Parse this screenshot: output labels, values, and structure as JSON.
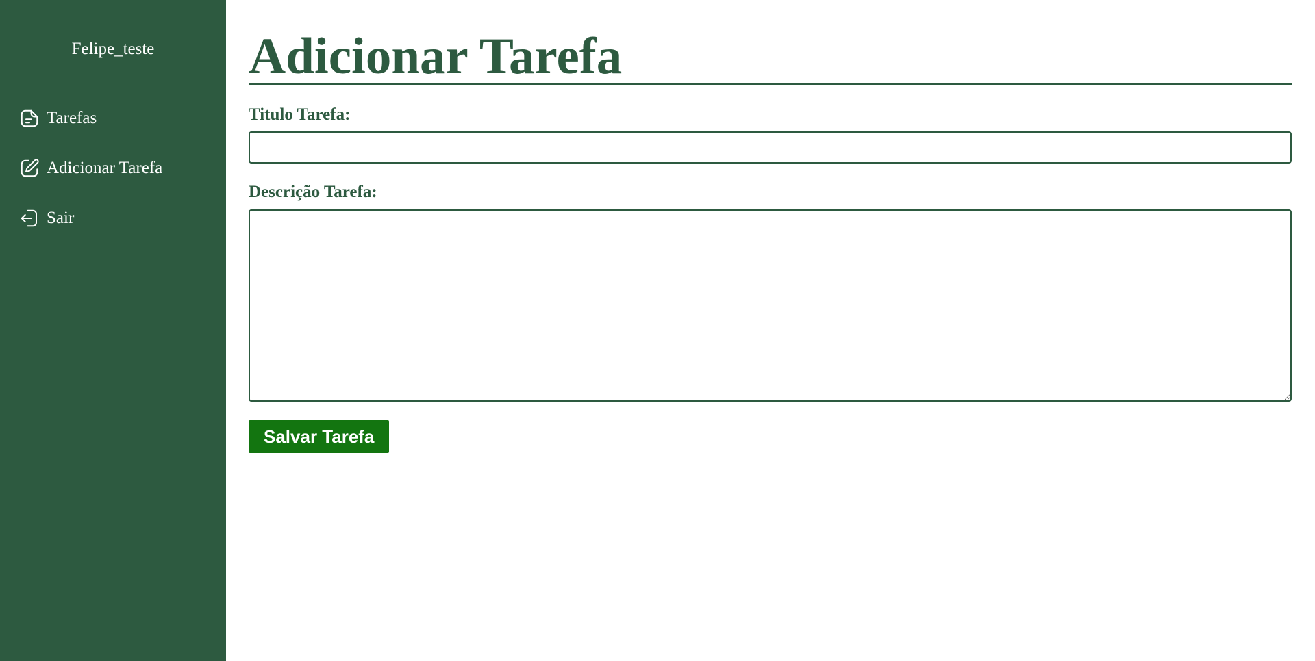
{
  "sidebar": {
    "username": "Felipe_teste",
    "items": [
      {
        "label": "Tarefas",
        "icon": "note-icon"
      },
      {
        "label": "Adicionar Tarefa",
        "icon": "edit-icon"
      },
      {
        "label": "Sair",
        "icon": "logout-icon"
      }
    ]
  },
  "main": {
    "title": "Adicionar Tarefa",
    "title_label": "Titulo Tarefa:",
    "title_value": "",
    "description_label": "Descrição Tarefa:",
    "description_value": "",
    "save_label": "Salvar Tarefa"
  },
  "colors": {
    "sidebar_bg": "#2d5a40",
    "accent": "#2d5a40",
    "button_bg": "#137510",
    "text_light": "#ffffff"
  }
}
